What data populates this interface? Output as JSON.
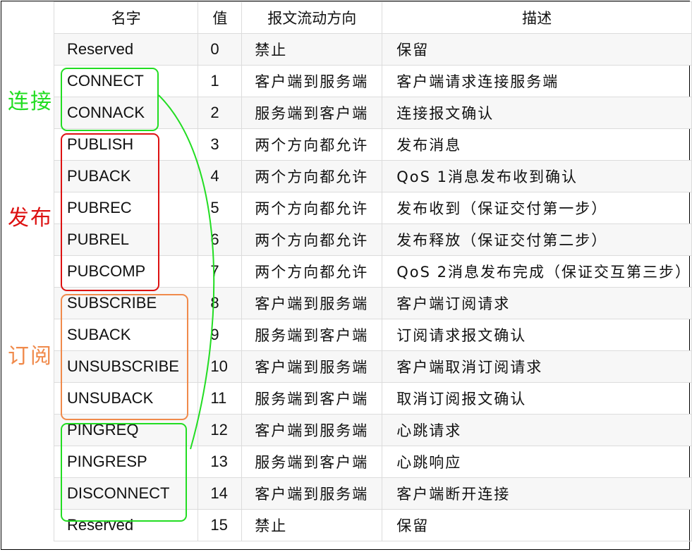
{
  "columns": [
    "名字",
    "值",
    "报文流动方向",
    "描述"
  ],
  "rows": [
    {
      "name": "Reserved",
      "value": "0",
      "direction": "禁止",
      "description": "保留"
    },
    {
      "name": "CONNECT",
      "value": "1",
      "direction": "客户端到服务端",
      "description": "客户端请求连接服务端"
    },
    {
      "name": "CONNACK",
      "value": "2",
      "direction": "服务端到客户端",
      "description": "连接报文确认"
    },
    {
      "name": "PUBLISH",
      "value": "3",
      "direction": "两个方向都允许",
      "description": "发布消息"
    },
    {
      "name": "PUBACK",
      "value": "4",
      "direction": "两个方向都允许",
      "description": "QoS 1消息发布收到确认"
    },
    {
      "name": "PUBREC",
      "value": "5",
      "direction": "两个方向都允许",
      "description": "发布收到（保证交付第一步）"
    },
    {
      "name": "PUBREL",
      "value": "6",
      "direction": "两个方向都允许",
      "description": "发布释放（保证交付第二步）"
    },
    {
      "name": "PUBCOMP",
      "value": "7",
      "direction": "两个方向都允许",
      "description": "QoS 2消息发布完成（保证交互第三步）"
    },
    {
      "name": "SUBSCRIBE",
      "value": "8",
      "direction": "客户端到服务端",
      "description": "客户端订阅请求"
    },
    {
      "name": "SUBACK",
      "value": "9",
      "direction": "服务端到客户端",
      "description": "订阅请求报文确认"
    },
    {
      "name": "UNSUBSCRIBE",
      "value": "10",
      "direction": "客户端到服务端",
      "description": "客户端取消订阅请求"
    },
    {
      "name": "UNSUBACK",
      "value": "11",
      "direction": "服务端到客户端",
      "description": "取消订阅报文确认"
    },
    {
      "name": "PINGREQ",
      "value": "12",
      "direction": "客户端到服务端",
      "description": "心跳请求"
    },
    {
      "name": "PINGRESP",
      "value": "13",
      "direction": "服务端到客户端",
      "description": "心跳响应"
    },
    {
      "name": "DISCONNECT",
      "value": "14",
      "direction": "客户端到服务端",
      "description": "客户端断开连接"
    },
    {
      "name": "Reserved",
      "value": "15",
      "direction": "禁止",
      "description": "保留"
    }
  ],
  "annotations": {
    "connect": {
      "label": "连接",
      "color": "#22dd22"
    },
    "publish": {
      "label": "发布",
      "color": "#dd1111"
    },
    "subscribe": {
      "label": "订阅",
      "color": "#f08a4b"
    },
    "ping": {
      "color": "#22dd22"
    }
  }
}
